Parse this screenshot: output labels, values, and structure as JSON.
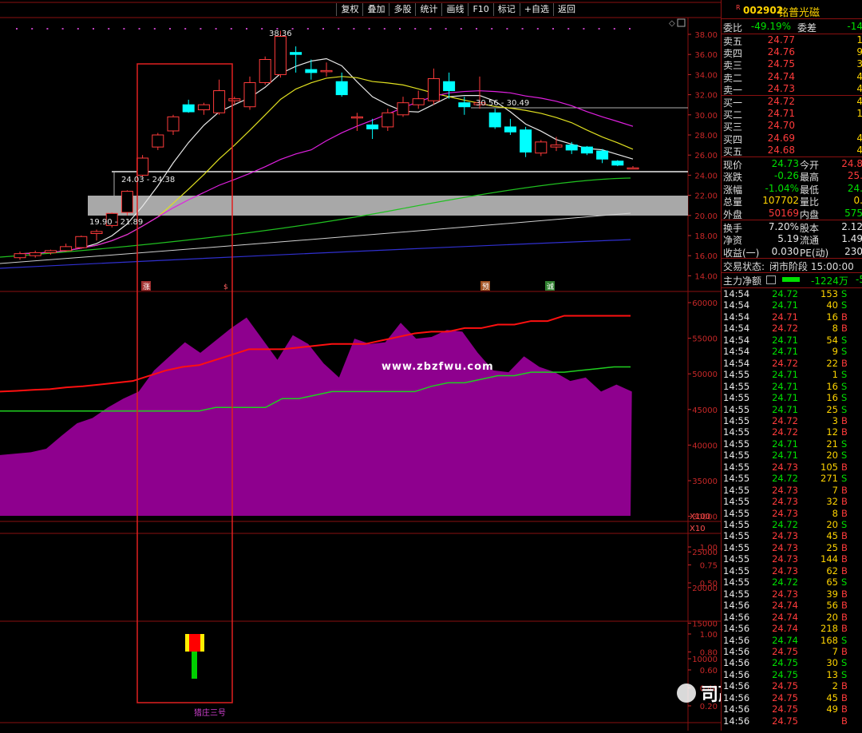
{
  "toolbar": {
    "buttons": [
      "复权",
      "叠加",
      "多股",
      "统计",
      "画线",
      "F10",
      "标记",
      "+自选",
      "返回"
    ]
  },
  "main_chart": {
    "y_ticks": [
      "38.00",
      "36.00",
      "34.00",
      "32.00",
      "30.00",
      "28.00",
      "26.00",
      "24.00",
      "22.00",
      "20.00",
      "18.00",
      "16.00",
      "14.00"
    ],
    "annotations": {
      "high": "38.36",
      "zone1": "24.03 - 24.38",
      "zone2": "19.90 - 21.89",
      "zone3": "30.56 - 30.49"
    },
    "markers": [
      "涨",
      "$",
      "预",
      "诚"
    ]
  },
  "volume_chart": {
    "y_ticks": [
      "60000",
      "55000",
      "50000",
      "45000",
      "40000",
      "35000",
      "30000",
      "25000",
      "20000",
      "15000",
      "10000"
    ],
    "scale": "X100"
  },
  "ind1": {
    "scale": "X10",
    "y_ticks": [
      "1.00",
      "0.75",
      "0.50"
    ]
  },
  "ind2": {
    "y_ticks": [
      "1.00",
      "0.80",
      "0.60",
      "0.40",
      "0.20"
    ],
    "title": "猎庄三号"
  },
  "watermark": "www.zbzfwu.com",
  "brand": "司赢空指标所",
  "colors": {
    "up": "#ff3b3b",
    "down": "#00ffff",
    "bg": "#000000",
    "frame": "#8a1010",
    "area": "#8e008e"
  },
  "stock": {
    "code": "002902",
    "name": "铭普光磁",
    "flag": "R"
  },
  "weibi": {
    "label1": "委比",
    "value1": "-49.19%",
    "label2": "委差",
    "value2": "-14"
  },
  "asks": [
    {
      "label": "卖五",
      "price": "24.77",
      "vol": "1"
    },
    {
      "label": "卖四",
      "price": "24.76",
      "vol": "9"
    },
    {
      "label": "卖三",
      "price": "24.75",
      "vol": "3"
    },
    {
      "label": "卖二",
      "price": "24.74",
      "vol": "4"
    },
    {
      "label": "卖一",
      "price": "24.73",
      "vol": "4"
    }
  ],
  "bids": [
    {
      "label": "买一",
      "price": "24.72",
      "vol": "4"
    },
    {
      "label": "买二",
      "price": "24.71",
      "vol": "1"
    },
    {
      "label": "买三",
      "price": "24.70",
      "vol": ""
    },
    {
      "label": "买四",
      "price": "24.69",
      "vol": "4"
    },
    {
      "label": "买五",
      "price": "24.68",
      "vol": "4"
    }
  ],
  "quote": [
    {
      "l1": "现价",
      "v1": "24.73",
      "c1": "grn",
      "l2": "今开",
      "v2": "24.8",
      "c2": "red"
    },
    {
      "l1": "涨跌",
      "v1": "-0.26",
      "c1": "grn",
      "l2": "最高",
      "v2": "25.",
      "c2": "red"
    },
    {
      "l1": "涨幅",
      "v1": "-1.04%",
      "c1": "grn",
      "l2": "最低",
      "v2": "24.",
      "c2": "grn"
    },
    {
      "l1": "总量",
      "v1": "107702",
      "c1": "yel",
      "l2": "量比",
      "v2": "0.",
      "c2": "yel"
    },
    {
      "l1": "外盘",
      "v1": "50169",
      "c1": "red",
      "l2": "内盘",
      "v2": "575",
      "c2": "grn"
    }
  ],
  "fundamentals": [
    {
      "l1": "换手",
      "v1": "7.20%",
      "l2": "股本",
      "v2": "2.12"
    },
    {
      "l1": "净资",
      "v1": "5.19",
      "l2": "流通",
      "v2": "1.49"
    },
    {
      "l1": "收益(一)",
      "v1": "0.030",
      "l2": "PE(动)",
      "v2": "230"
    }
  ],
  "status": {
    "label": "交易状态:",
    "value": "闭市阶段 15:00:00"
  },
  "main_force": {
    "label": "主力净额",
    "value": "-1224万",
    "extra": "-5"
  },
  "ticks": [
    [
      "14:54",
      "24.72",
      "153",
      "S"
    ],
    [
      "14:54",
      "24.71",
      "40",
      "S"
    ],
    [
      "14:54",
      "24.71",
      "16",
      "B"
    ],
    [
      "14:54",
      "24.72",
      "8",
      "B"
    ],
    [
      "14:54",
      "24.71",
      "54",
      "S"
    ],
    [
      "14:54",
      "24.71",
      "9",
      "S"
    ],
    [
      "14:54",
      "24.72",
      "22",
      "B"
    ],
    [
      "14:55",
      "24.71",
      "1",
      "S"
    ],
    [
      "14:55",
      "24.71",
      "16",
      "S"
    ],
    [
      "14:55",
      "24.71",
      "16",
      "S"
    ],
    [
      "14:55",
      "24.71",
      "25",
      "S"
    ],
    [
      "14:55",
      "24.72",
      "3",
      "B"
    ],
    [
      "14:55",
      "24.72",
      "12",
      "B"
    ],
    [
      "14:55",
      "24.71",
      "21",
      "S"
    ],
    [
      "14:55",
      "24.71",
      "20",
      "S"
    ],
    [
      "14:55",
      "24.73",
      "105",
      "B"
    ],
    [
      "14:55",
      "24.72",
      "271",
      "S"
    ],
    [
      "14:55",
      "24.73",
      "7",
      "B"
    ],
    [
      "14:55",
      "24.73",
      "32",
      "B"
    ],
    [
      "14:55",
      "24.73",
      "8",
      "B"
    ],
    [
      "14:55",
      "24.72",
      "20",
      "S"
    ],
    [
      "14:55",
      "24.73",
      "45",
      "B"
    ],
    [
      "14:55",
      "24.73",
      "25",
      "B"
    ],
    [
      "14:55",
      "24.73",
      "144",
      "B"
    ],
    [
      "14:55",
      "24.73",
      "62",
      "B"
    ],
    [
      "14:55",
      "24.72",
      "65",
      "S"
    ],
    [
      "14:55",
      "24.73",
      "39",
      "B"
    ],
    [
      "14:56",
      "24.74",
      "56",
      "B"
    ],
    [
      "14:56",
      "24.74",
      "20",
      "B"
    ],
    [
      "14:56",
      "24.74",
      "218",
      "B"
    ],
    [
      "14:56",
      "24.74",
      "168",
      "S"
    ],
    [
      "14:56",
      "24.75",
      "7",
      "B"
    ],
    [
      "14:56",
      "24.75",
      "30",
      "S"
    ],
    [
      "14:56",
      "24.75",
      "13",
      "S"
    ],
    [
      "14:56",
      "24.75",
      "2",
      "B"
    ],
    [
      "14:56",
      "24.75",
      "45",
      "B"
    ],
    [
      "14:56",
      "24.75",
      "49",
      "B"
    ],
    [
      "14:56",
      "24.75",
      "",
      "B"
    ]
  ]
}
